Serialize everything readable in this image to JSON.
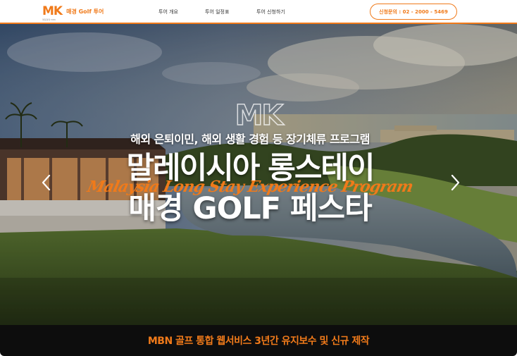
{
  "header": {
    "logo_mark": "MK",
    "logo_sub": "매일경제 MBN",
    "logo_text": "매경 Golf 투어",
    "nav": [
      "투어 개요",
      "투어 일정표",
      "투어 신청하기"
    ],
    "contact_label": "신청문의 : 02 - 2000 - 5469"
  },
  "hero": {
    "watermark": "MK",
    "subtitle": "해외 은퇴이민, 해외 생활 경험 등 장기체류 프로그램",
    "title_line1": "말레이시아 롱스테이",
    "script_text": "Malaysia Long Stay Experience Program",
    "title_line2": "매경 GOLF 페스타"
  },
  "footer_bar": {
    "text": "MBN 골프 통합 웹서비스 3년간 유지보수 및 신규 제작"
  },
  "colors": {
    "accent": "#f07a1a",
    "bar_bg": "#0d0d0d"
  },
  "icons": [
    "chevron-left-icon",
    "chevron-right-icon"
  ]
}
